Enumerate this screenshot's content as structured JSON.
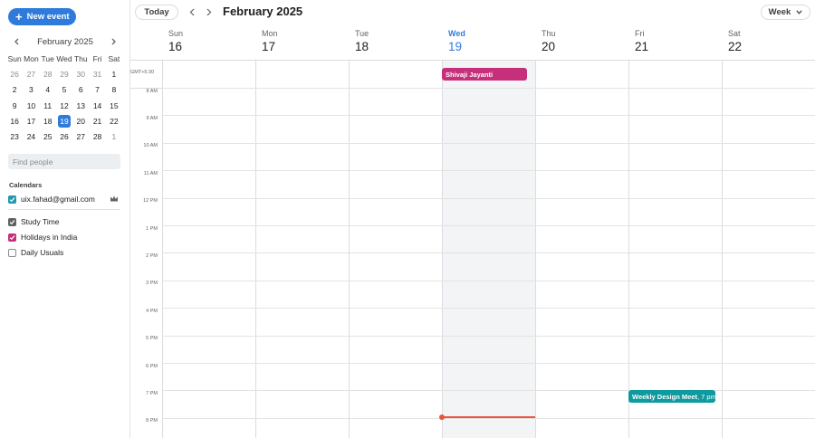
{
  "sidebar": {
    "new_event_label": "New event",
    "mini_calendar": {
      "title": "February 2025",
      "weekdays": [
        "Sun",
        "Mon",
        "Tue",
        "Wed",
        "Thu",
        "Fri",
        "Sat"
      ],
      "weeks": [
        [
          {
            "d": "26",
            "o": true
          },
          {
            "d": "27",
            "o": true
          },
          {
            "d": "28",
            "o": true
          },
          {
            "d": "29",
            "o": true
          },
          {
            "d": "30",
            "o": true
          },
          {
            "d": "31",
            "o": true
          },
          {
            "d": "1",
            "o": false
          }
        ],
        [
          {
            "d": "2",
            "o": false
          },
          {
            "d": "3",
            "o": false
          },
          {
            "d": "4",
            "o": false
          },
          {
            "d": "5",
            "o": false
          },
          {
            "d": "6",
            "o": false
          },
          {
            "d": "7",
            "o": false
          },
          {
            "d": "8",
            "o": false
          }
        ],
        [
          {
            "d": "9",
            "o": false
          },
          {
            "d": "10",
            "o": false
          },
          {
            "d": "11",
            "o": false
          },
          {
            "d": "12",
            "o": false
          },
          {
            "d": "13",
            "o": false
          },
          {
            "d": "14",
            "o": false
          },
          {
            "d": "15",
            "o": false
          }
        ],
        [
          {
            "d": "16",
            "o": false
          },
          {
            "d": "17",
            "o": false
          },
          {
            "d": "18",
            "o": false
          },
          {
            "d": "19",
            "o": false,
            "today": true
          },
          {
            "d": "20",
            "o": false
          },
          {
            "d": "21",
            "o": false
          },
          {
            "d": "22",
            "o": false
          }
        ],
        [
          {
            "d": "23",
            "o": false
          },
          {
            "d": "24",
            "o": false
          },
          {
            "d": "25",
            "o": false
          },
          {
            "d": "26",
            "o": false
          },
          {
            "d": "27",
            "o": false
          },
          {
            "d": "28",
            "o": false
          },
          {
            "d": "1",
            "o": true
          }
        ]
      ]
    },
    "find_people_placeholder": "Find people",
    "calendars_title": "Calendars",
    "calendars": [
      {
        "label": "uix.fahad@gmail.com",
        "checked": true,
        "color": "#1a9bb0",
        "owner": true
      },
      {
        "label": "Study Time",
        "checked": true,
        "color": "#616161"
      },
      {
        "label": "Holidays in India",
        "checked": true,
        "color": "#c6307b"
      },
      {
        "label": "Daily Usuals",
        "checked": false,
        "color": "#8a8d91"
      }
    ]
  },
  "toolbar": {
    "today_label": "Today",
    "month_title": "February 2025",
    "view_label": "Week"
  },
  "week": {
    "days": [
      {
        "name": "Sun",
        "num": "16",
        "today": false
      },
      {
        "name": "Mon",
        "num": "17",
        "today": false
      },
      {
        "name": "Tue",
        "num": "18",
        "today": false
      },
      {
        "name": "Wed",
        "num": "19",
        "today": true
      },
      {
        "name": "Thu",
        "num": "20",
        "today": false
      },
      {
        "name": "Fri",
        "num": "21",
        "today": false
      },
      {
        "name": "Sat",
        "num": "22",
        "today": false
      }
    ],
    "timezone": "GMT+5:30",
    "hours": [
      "8 AM",
      "9 AM",
      "10 AM",
      "11 AM",
      "12 PM",
      "1 PM",
      "2 PM",
      "3 PM",
      "4 PM",
      "5 PM",
      "6 PM",
      "7 PM",
      "8 PM"
    ]
  },
  "events": {
    "shivaji": {
      "title": "Shivaji Jayanti",
      "color": "#c6307b"
    },
    "weekly": {
      "title": "Weekly Design Meet",
      "time": ", 7 pm",
      "color": "#0f9aa0"
    }
  },
  "colors": {
    "accent": "#2f7bdc",
    "now_line": "#e8553e"
  }
}
